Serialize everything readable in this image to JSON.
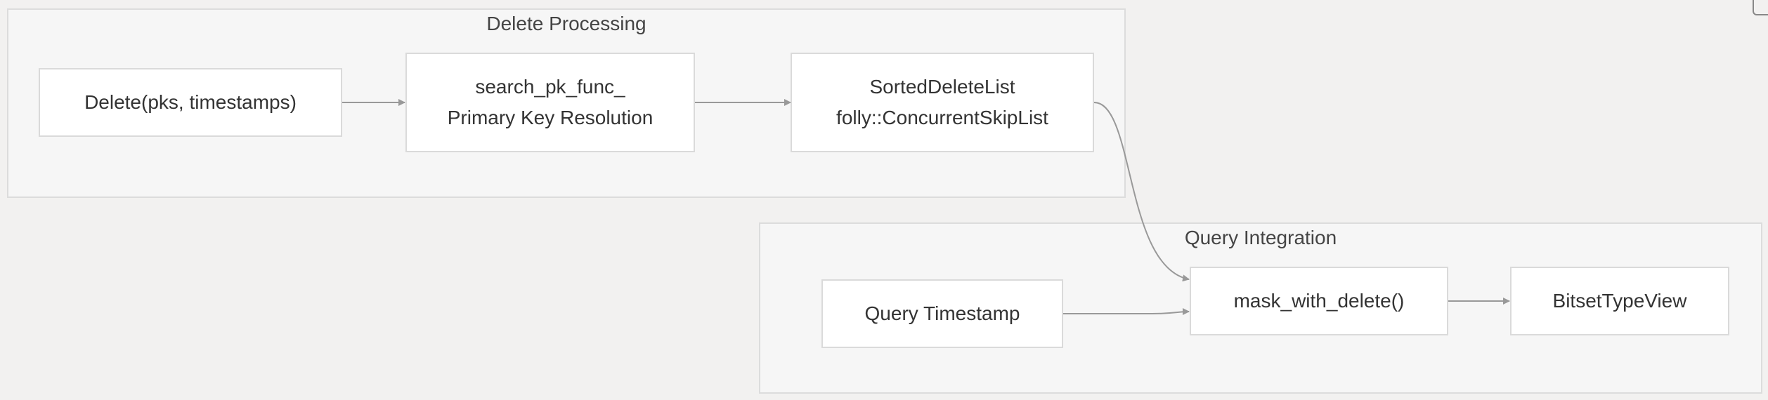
{
  "clusters": {
    "delete_processing": {
      "title": "Delete Processing"
    },
    "query_integration": {
      "title": "Query Integration"
    }
  },
  "nodes": {
    "delete_call": {
      "lines": [
        "Delete(pks, timestamps)"
      ]
    },
    "search_pk": {
      "lines": [
        "search_pk_func_",
        "Primary Key Resolution"
      ]
    },
    "sorted_delete_list": {
      "lines": [
        "SortedDeleteList",
        "folly::ConcurrentSkipList"
      ]
    },
    "query_timestamp": {
      "lines": [
        "Query Timestamp"
      ]
    },
    "mask_with_delete": {
      "lines": [
        "mask_with_delete()"
      ]
    },
    "bitset_view": {
      "lines": [
        "BitsetTypeView"
      ]
    }
  },
  "edges": [
    {
      "from": "Delete(pks, timestamps)",
      "to": "search_pk_func_"
    },
    {
      "from": "search_pk_func_",
      "to": "SortedDeleteList"
    },
    {
      "from": "SortedDeleteList",
      "to": "mask_with_delete()"
    },
    {
      "from": "Query Timestamp",
      "to": "mask_with_delete()"
    },
    {
      "from": "mask_with_delete()",
      "to": "BitsetTypeView"
    }
  ],
  "colors": {
    "background": "#f2f1f0",
    "cluster_fill": "#f6f6f6",
    "cluster_border": "#dcdcdc",
    "node_fill": "#ffffff",
    "node_border": "#dadada",
    "edge": "#999999",
    "text": "#333333"
  },
  "icons": {
    "corner": "expand-icon"
  }
}
